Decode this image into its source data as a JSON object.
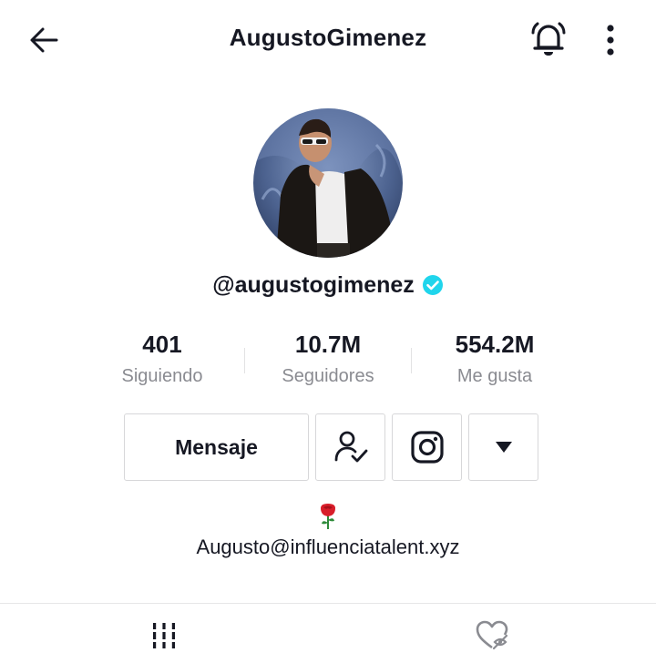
{
  "header": {
    "title": "AugustoGimenez",
    "back_icon": "arrow-left-icon",
    "bell_icon": "bell-icon",
    "more_icon": "more-vertical-icon"
  },
  "profile": {
    "handle": "@augustogimenez",
    "verified": true,
    "verified_color": "#20d5ec"
  },
  "stats": [
    {
      "value": "401",
      "label": "Siguiendo"
    },
    {
      "value": "10.7M",
      "label": "Seguidores"
    },
    {
      "value": "554.2M",
      "label": "Me gusta"
    }
  ],
  "actions": {
    "message_label": "Mensaje",
    "following_icon": "user-check-icon",
    "instagram_icon": "instagram-icon",
    "dropdown_icon": "caret-down-icon"
  },
  "bio": {
    "emoji": "rose-icon",
    "link_text": "Augusto@influenciatalent.xyz"
  },
  "tabs": {
    "videos_icon": "grid-bars-icon",
    "liked_icon": "hidden-heart-icon"
  },
  "colors": {
    "text": "#161823",
    "muted": "#8a8b91",
    "border": "#d7d7d9"
  }
}
